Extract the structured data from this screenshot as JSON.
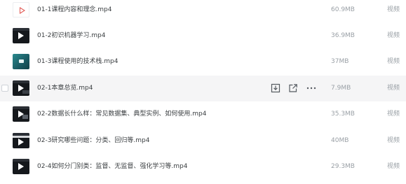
{
  "files": [
    {
      "name": "01-1课程内容和理念.mp4",
      "size": "60.9MB",
      "type": "视频",
      "thumb": "pdf-play-icon"
    },
    {
      "name": "01-2初识机器学习.mp4",
      "size": "36.9MB",
      "type": "视频",
      "thumb": "video-thumbnail"
    },
    {
      "name": "01-3课程使用的技术栈.mp4",
      "size": "37MB",
      "type": "视频",
      "thumb": "video-thumbnail"
    },
    {
      "name": "02-1本章总览.mp4",
      "size": "7.9MB",
      "type": "视频",
      "thumb": "video-thumbnail"
    },
    {
      "name": "02-2数据长什么样：常见数据集、典型实例、如何使用.mp4",
      "size": "35.3MB",
      "type": "视频",
      "thumb": "video-thumbnail"
    },
    {
      "name": "02-3研究哪些问题：分类、回归等.mp4",
      "size": "40MB",
      "type": "视频",
      "thumb": "video-thumbnail"
    },
    {
      "name": "02-4如何分门别类：监督、无监督、强化学习等.mp4",
      "size": "29.3MB",
      "type": "视频",
      "thumb": "video-thumbnail"
    }
  ],
  "hover_actions": {
    "download_icon": "download-icon",
    "share_icon": "share-icon",
    "more_icon": "more-icon"
  },
  "colors": {
    "hover_row": "#f5f5f6",
    "name_text": "#3c4043",
    "meta_text": "#9aa0a6"
  }
}
